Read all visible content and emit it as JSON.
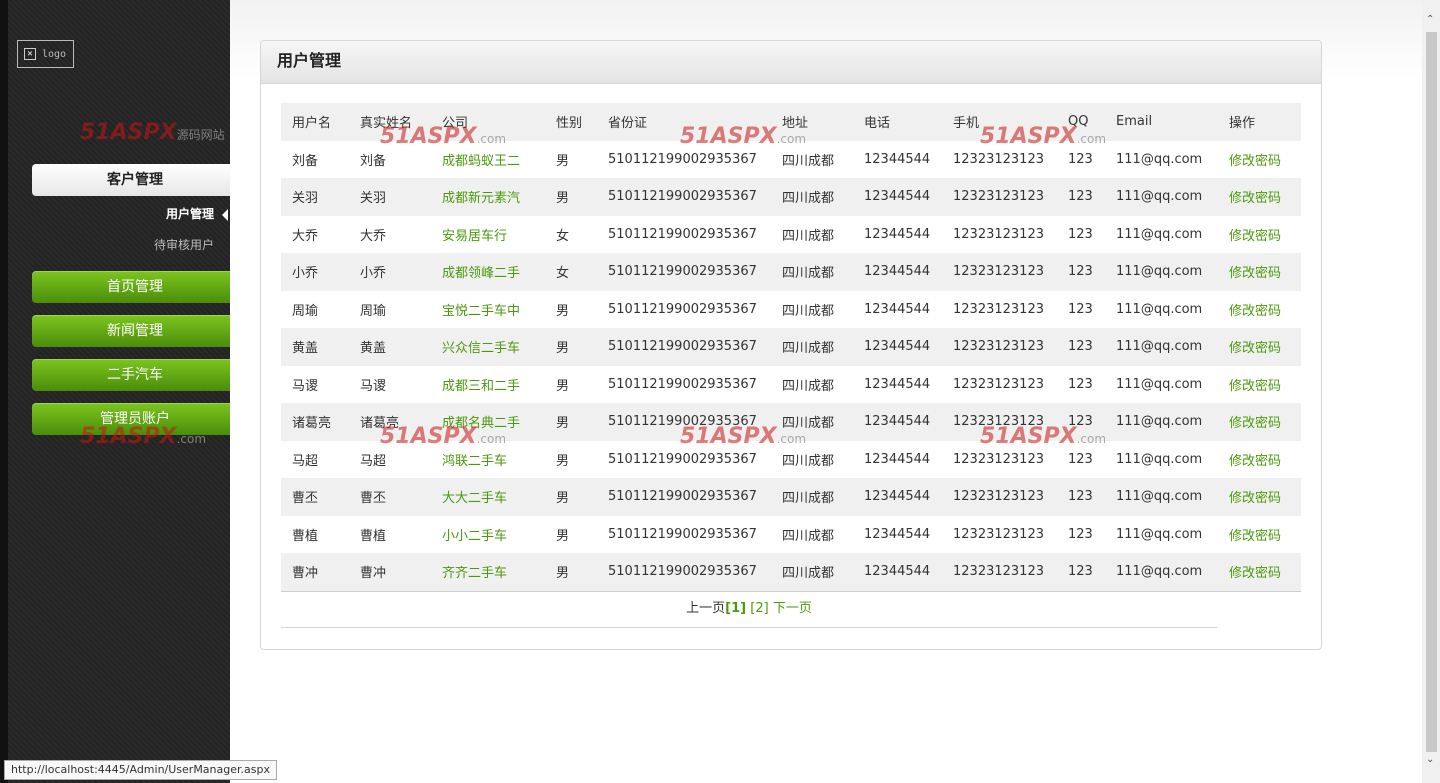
{
  "logo": {
    "text": "logo"
  },
  "sidebar": {
    "section": "客户管理",
    "sub_items": [
      {
        "label": "用户管理"
      },
      {
        "label": "待审核用户"
      }
    ],
    "nav": [
      {
        "label": "首页管理"
      },
      {
        "label": "新闻管理"
      },
      {
        "label": "二手汽车"
      },
      {
        "label": "管理员账户"
      }
    ]
  },
  "watermark": {
    "brand": "51ASPX",
    "suffix": ".com",
    "tag": "源码网站"
  },
  "panel": {
    "title": "用户管理"
  },
  "table": {
    "headers": [
      "用户名",
      "真实姓名",
      "公司",
      "性别",
      "省份证",
      "地址",
      "电话",
      "手机",
      "QQ",
      "Email",
      "操作"
    ],
    "rows": [
      [
        "刘备",
        "刘备",
        "成都蚂蚁王二",
        "男",
        "510112199002935367",
        "四川成都",
        "12344544",
        "12323123123",
        "123",
        "111@qq.com",
        "修改密码"
      ],
      [
        "关羽",
        "关羽",
        "成都新元素汽",
        "男",
        "510112199002935367",
        "四川成都",
        "12344544",
        "12323123123",
        "123",
        "111@qq.com",
        "修改密码"
      ],
      [
        "大乔",
        "大乔",
        "安易居车行",
        "女",
        "510112199002935367",
        "四川成都",
        "12344544",
        "12323123123",
        "123",
        "111@qq.com",
        "修改密码"
      ],
      [
        "小乔",
        "小乔",
        "成都领峰二手",
        "女",
        "510112199002935367",
        "四川成都",
        "12344544",
        "12323123123",
        "123",
        "111@qq.com",
        "修改密码"
      ],
      [
        "周瑜",
        "周瑜",
        "宝悦二手车中",
        "男",
        "510112199002935367",
        "四川成都",
        "12344544",
        "12323123123",
        "123",
        "111@qq.com",
        "修改密码"
      ],
      [
        "黄盖",
        "黄盖",
        "兴众信二手车",
        "男",
        "510112199002935367",
        "四川成都",
        "12344544",
        "12323123123",
        "123",
        "111@qq.com",
        "修改密码"
      ],
      [
        "马谡",
        "马谡",
        "成都三和二手",
        "男",
        "510112199002935367",
        "四川成都",
        "12344544",
        "12323123123",
        "123",
        "111@qq.com",
        "修改密码"
      ],
      [
        "诸葛亮",
        "诸葛亮",
        "成都名典二手",
        "男",
        "510112199002935367",
        "四川成都",
        "12344544",
        "12323123123",
        "123",
        "111@qq.com",
        "修改密码"
      ],
      [
        "马超",
        "马超",
        "鸿联二手车",
        "男",
        "510112199002935367",
        "四川成都",
        "12344544",
        "12323123123",
        "123",
        "111@qq.com",
        "修改密码"
      ],
      [
        "曹丕",
        "曹丕",
        "大大二手车",
        "男",
        "510112199002935367",
        "四川成都",
        "12344544",
        "12323123123",
        "123",
        "111@qq.com",
        "修改密码"
      ],
      [
        "曹植",
        "曹植",
        "小小二手车",
        "男",
        "510112199002935367",
        "四川成都",
        "12344544",
        "12323123123",
        "123",
        "111@qq.com",
        "修改密码"
      ],
      [
        "曹冲",
        "曹冲",
        "齐齐二手车",
        "男",
        "510112199002935367",
        "四川成都",
        "12344544",
        "12323123123",
        "123",
        "111@qq.com",
        "修改密码"
      ]
    ]
  },
  "pager": {
    "prev": "上一页",
    "page1": "[1]",
    "page2": "[2]",
    "next": "下一页"
  },
  "statusbar": {
    "url": "http://localhost:4445/Admin/UserManager.aspx"
  },
  "colors": {
    "accent_green": "#4b9a0c",
    "nav_green": "#6ab014"
  }
}
